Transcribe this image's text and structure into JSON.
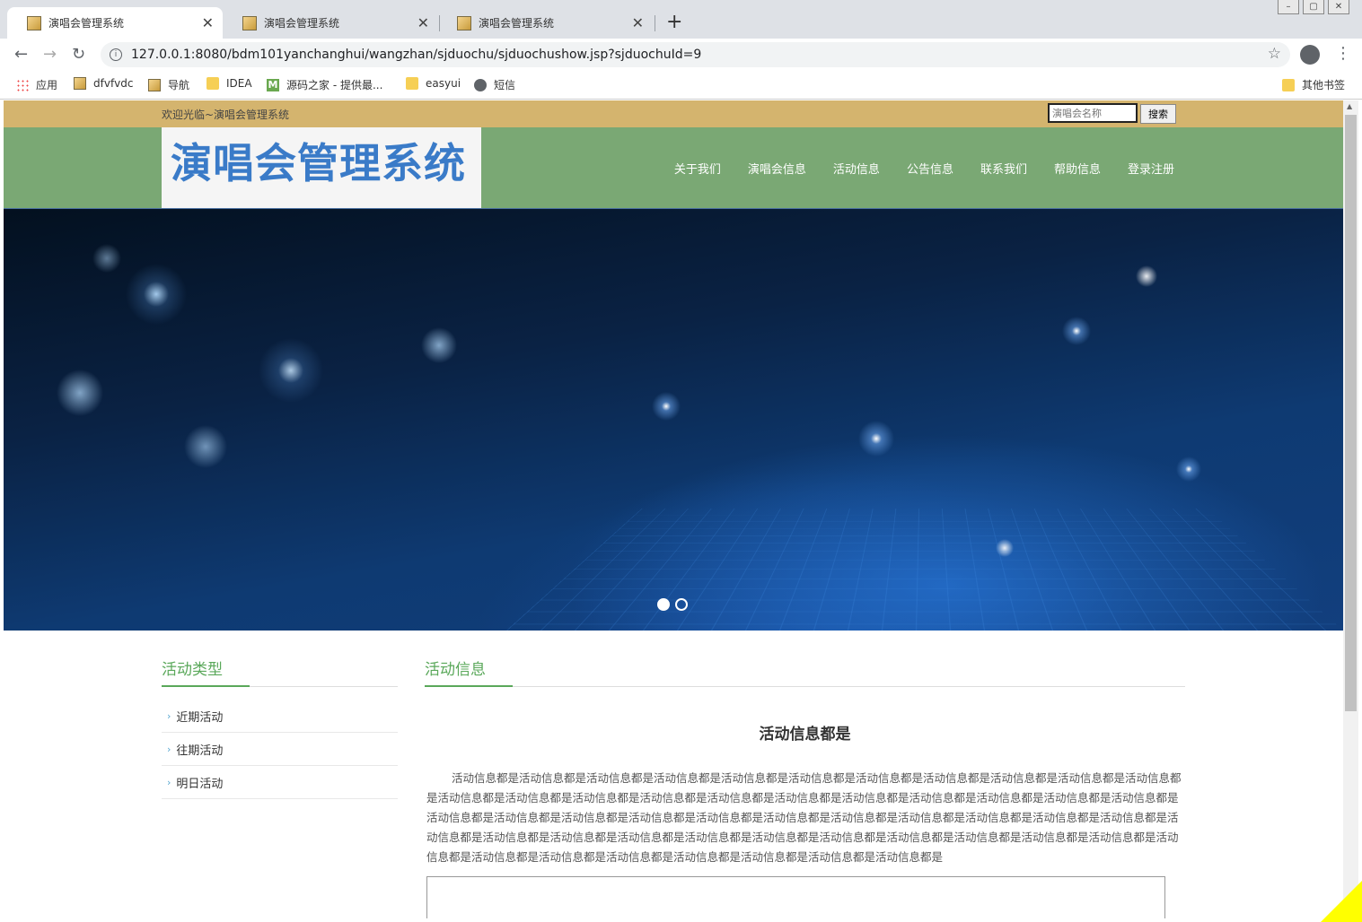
{
  "browser": {
    "tabs": [
      {
        "title": "演唱会管理系统",
        "active": true
      },
      {
        "title": "演唱会管理系统",
        "active": false
      },
      {
        "title": "演唱会管理系统",
        "active": false
      }
    ],
    "url": "127.0.0.1:8080/bdm101yanchanghui/wangzhan/sjduochu/sjduochushow.jsp?sjduochuId=9",
    "bookmarks": [
      {
        "label": "应用",
        "icon": "apps-icon"
      },
      {
        "label": "dfvfvdc",
        "icon": "picture-icon"
      },
      {
        "label": "导航",
        "icon": "picture-icon"
      },
      {
        "label": "IDEA",
        "icon": "folder-icon"
      },
      {
        "label": "源码之家 - 提供最...",
        "icon": "m-icon"
      },
      {
        "label": "easyui",
        "icon": "folder-icon"
      },
      {
        "label": "短信",
        "icon": "globe-icon"
      }
    ],
    "other_bookmarks": "其他书签"
  },
  "site": {
    "welcome": "欢迎光临~演唱会管理系统",
    "search_placeholder": "演唱会名称",
    "search_button": "搜索",
    "logo": "演唱会管理系统",
    "nav": [
      "关于我们",
      "演唱会信息",
      "活动信息",
      "公告信息",
      "联系我们",
      "帮助信息",
      "登录注册"
    ],
    "carousel": {
      "slides": 2,
      "active_index": 0
    }
  },
  "sidebar": {
    "title": "活动类型",
    "items": [
      "近期活动",
      "往期活动",
      "明日活动"
    ]
  },
  "content": {
    "section_title": "活动信息",
    "article_title": "活动信息都是",
    "article_body": "活动信息都是活动信息都是活动信息都是活动信息都是活动信息都是活动信息都是活动信息都是活动信息都是活动信息都是活动信息都是活动信息都是活动信息都是活动信息都是活动信息都是活动信息都是活动信息都是活动信息都是活动信息都是活动信息都是活动信息都是活动信息都是活动信息都是活动信息都是活动信息都是活动信息都是活动信息都是活动信息都是活动信息都是活动信息都是活动信息都是活动信息都是活动信息都是活动信息都是活动信息都是活动信息都是活动信息都是活动信息都是活动信息都是活动信息都是活动信息都是活动信息都是活动信息都是活动信息都是活动信息都是活动信息都是活动信息都是活动信息都是活动信息都是活动信息都是活动信息都是活动信息都是活动信息都是"
  },
  "colors": {
    "topbar": "#d4b46e",
    "header": "#7aa874",
    "logo_text": "#3a7bc8",
    "accent_green": "#5aa85a"
  }
}
